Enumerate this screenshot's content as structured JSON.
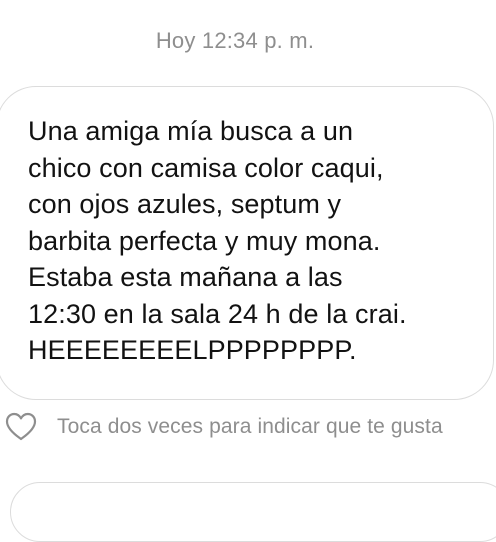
{
  "timestamp": "Hoy 12:34 p. m.",
  "message": {
    "text": "Una amiga mía busca a un\nchico con camisa color caqui,\ncon ojos azules, septum y\nbarbita perfecta y muy mona.\nEstaba esta mañana a las\n12:30 en la sala 24 h de la crai.\nHEEEEEEEELPPPPPPPP."
  },
  "like": {
    "icon": "heart-outline-icon",
    "hint": "Toca dos veces para indicar que te gusta"
  },
  "colors": {
    "bubble_border": "#dcdcdc",
    "muted_text": "#8e8e8e",
    "message_text": "#121212"
  }
}
